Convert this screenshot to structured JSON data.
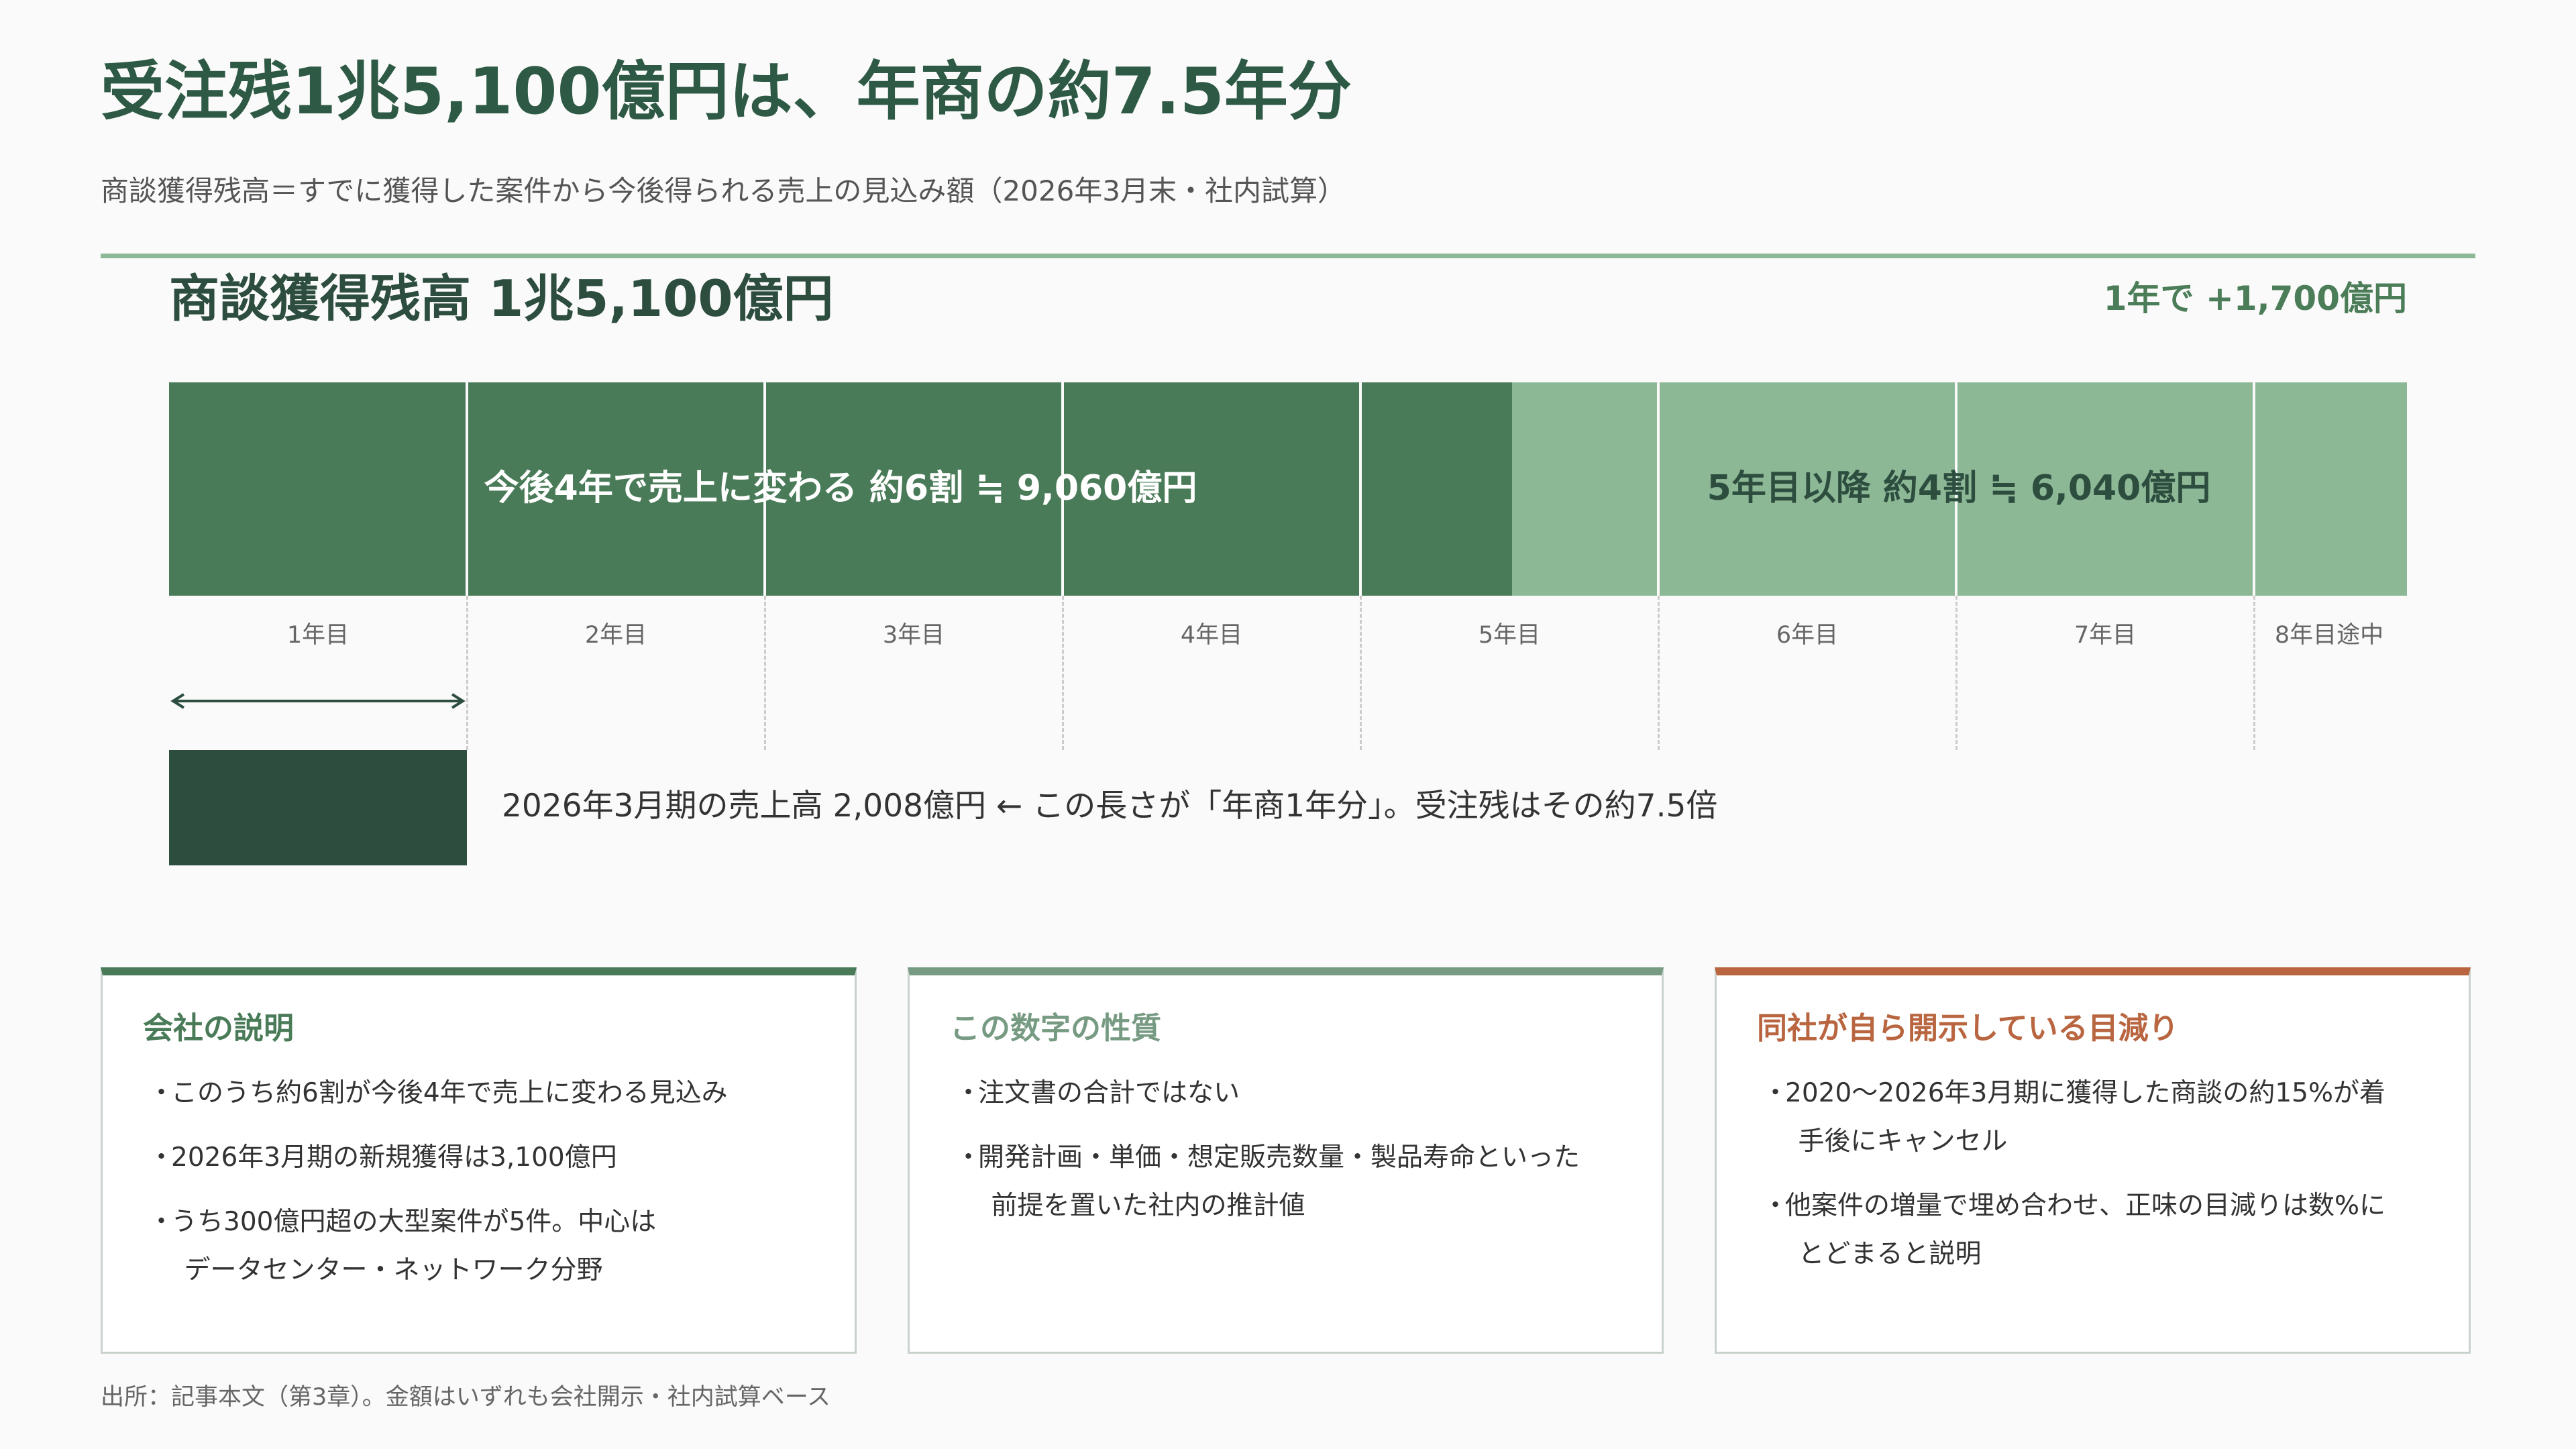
{
  "header": {
    "title": "受注残1兆5,100億円は、年商の約7.5年分",
    "subtitle": "商談獲得残高＝すでに獲得した案件から今後得られる売上の見込み額（2026年3月末・社内試算）"
  },
  "chart_data": {
    "type": "bar",
    "title": "商談獲得残高  1兆5,100億円",
    "annotation": "1年で +1,700億円",
    "categories": [
      "1年目",
      "2年目",
      "3年目",
      "4年目",
      "5年目",
      "6年目",
      "7年目",
      "8年目途中"
    ],
    "unit": "億円",
    "total": 15100,
    "segments": [
      {
        "label": "今後4年で売上に変わる  約6割 ≒ 9,060億円",
        "value": 9060,
        "share": 0.6,
        "color": "#4a7b58"
      },
      {
        "label": "5年目以降  約4割 ≒ 6,040億円",
        "value": 6040,
        "share": 0.4,
        "color": "#8db896"
      }
    ],
    "reference": {
      "label": "2026年3月期の売上高 2,008億円  ←  この長さが「年商1年分」。受注残はその約7.5倍",
      "value": 2008,
      "color": "#2d4d3f"
    }
  },
  "cards": [
    {
      "title": "会社の説明",
      "accent": "#4a7b58",
      "items": [
        "このうち約6割が今後4年で売上に変わる見込み",
        "2026年3月期の新規獲得は3,100億円",
        "うち300億円超の大型案件が5件。中心は\nデータセンター・ネットワーク分野"
      ]
    },
    {
      "title": "この数字の性質",
      "accent": "#779a82",
      "items": [
        "注文書の合計ではない",
        "開発計画・単価・想定販売数量・製品寿命といった\n前提を置いた社内の推計値"
      ]
    },
    {
      "title": "同社が自ら開示している目減り",
      "accent": "#b86540",
      "items": [
        "2020〜2026年3月期に獲得した商談の約15%が着\n手後にキャンセル",
        "他案件の増量で埋め合わせ、正味の目減りは数%に\nとどまると説明"
      ]
    }
  ],
  "bullet": "・",
  "source": "出所：記事本文（第3章）。金額はいずれも会社開示・社内試算ベース"
}
